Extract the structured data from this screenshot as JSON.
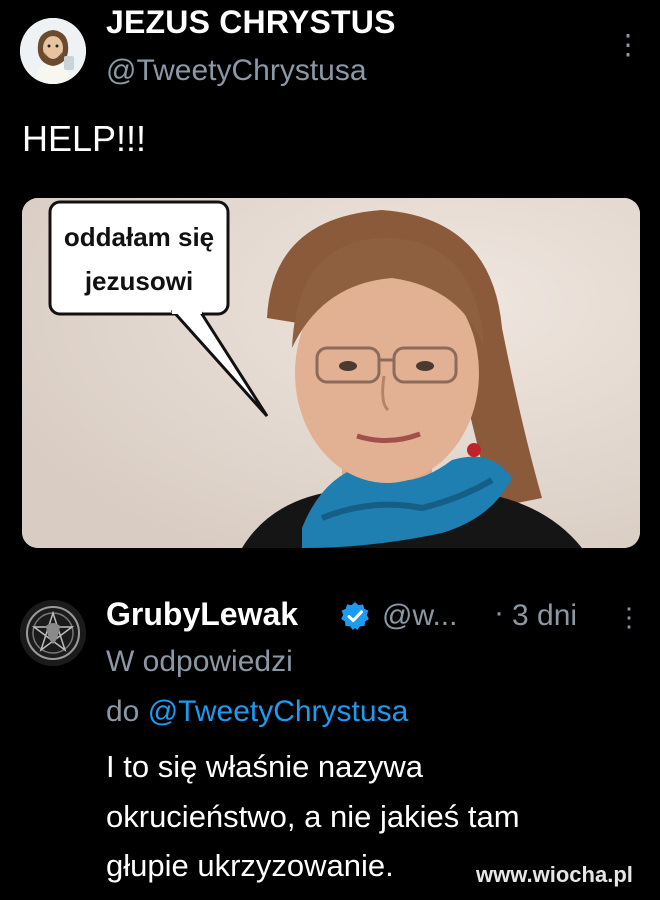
{
  "tweet": {
    "author_name": "JEZUS CHRYSTUS",
    "author_handle": "@TweetyChrystusa",
    "text": "HELP!!!",
    "more_icon": "more-vertical-icon"
  },
  "media": {
    "speech_bubble_line1": "oddałam się",
    "speech_bubble_line2": "jezusowi"
  },
  "reply": {
    "author_name": "GrubyLewak",
    "author_handle": "@w...",
    "separator": "·",
    "time": "3 dni",
    "replying_to_prefix": "W odpowiedzi",
    "replying_to_do": "do",
    "replying_to_handle": "@TweetyChrystusa",
    "text_line1": "I to się właśnie nazywa",
    "text_line2": "okrucieństwo, a nie jakieś tam",
    "text_line3": "głupie ukrzyzowanie.",
    "verified_icon": "verified-badge-icon",
    "more_icon": "more-vertical-icon"
  },
  "watermark": "www.wiocha.pl",
  "colors": {
    "background": "#000000",
    "primary_text": "#e7e9ea",
    "secondary_text": "#8b98a5",
    "link": "#1d9bf0"
  }
}
